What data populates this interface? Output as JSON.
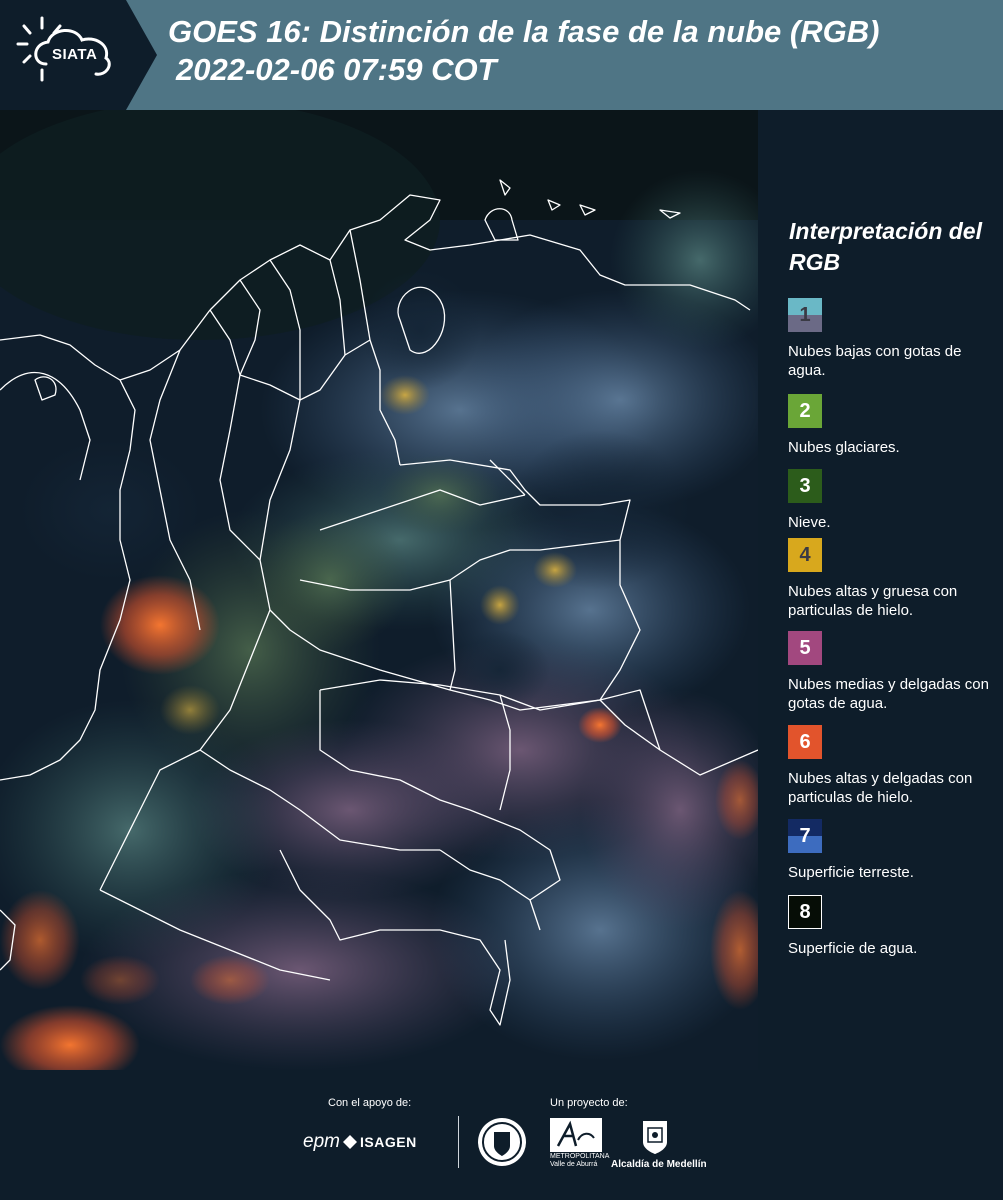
{
  "header": {
    "logo_text": "SIATA",
    "title_line1": "GOES 16: Distinción de la fase de la nube (RGB)",
    "title_line2": "2022-02-06 07:59 COT"
  },
  "legend": {
    "title": "Interpretación del RGB",
    "items": [
      {
        "number": "1",
        "label": "Nubes bajas con gotas de agua.",
        "color_top": "#6ab8c6",
        "color_bottom": "#6b6a86"
      },
      {
        "number": "2",
        "label": "Nubes glaciares.",
        "color_top": "#6aa637",
        "color_bottom": "#6aa637"
      },
      {
        "number": "3",
        "label": "Nieve.",
        "color_top": "#2c5c1b",
        "color_bottom": "#2c5c1b"
      },
      {
        "number": "4",
        "label": "Nubes altas y gruesa con particulas de hielo.",
        "color_top": "#d8a81d",
        "color_bottom": "#d8a81d"
      },
      {
        "number": "5",
        "label": "Nubes medias y delgadas con gotas de agua.",
        "color_top": "#a2487f",
        "color_bottom": "#a2487f"
      },
      {
        "number": "6",
        "label": "Nubes altas y delgadas con particulas de hielo.",
        "color_top": "#e2542c",
        "color_bottom": "#e2542c"
      },
      {
        "number": "7",
        "label": "Superficie terreste.",
        "color_top": "#132a63",
        "color_bottom": "#3d6cbf"
      },
      {
        "number": "8",
        "label": "Superficie de agua.",
        "color_top": "#060d06",
        "color_bottom": "#060d06"
      }
    ]
  },
  "footer": {
    "support_label": "Con el apoyo de:",
    "project_label": "Un proyecto de:",
    "sponsors": [
      "epm",
      "ISAGEN"
    ],
    "amva_lines": [
      "METROPOLITANA",
      "Valle de Aburrá"
    ],
    "alcaldia": "Alcaldía de Medellín"
  }
}
